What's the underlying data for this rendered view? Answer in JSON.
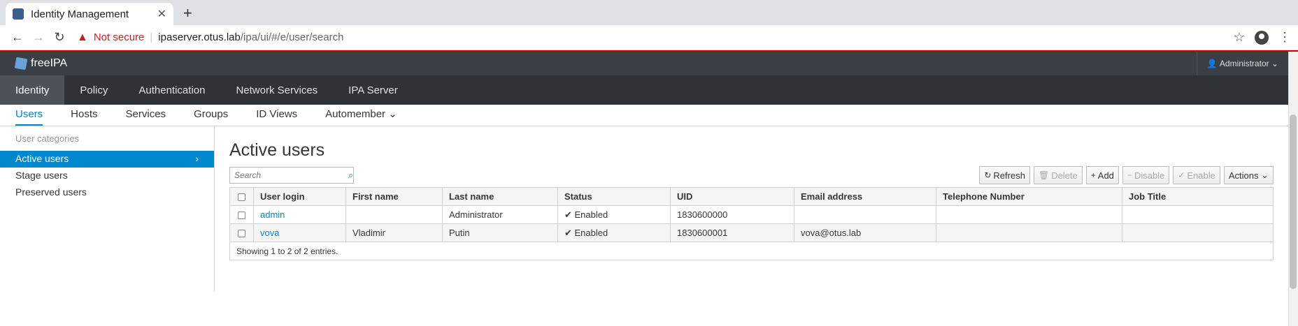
{
  "browser": {
    "tab_title": "Identity Management",
    "not_secure": "Not secure",
    "url_host": "ipaserver.otus.lab",
    "url_path": "/ipa/ui/#/e/user/search"
  },
  "masthead": {
    "brand": "freeIPA",
    "user": "Administrator"
  },
  "primary_nav": [
    "Identity",
    "Policy",
    "Authentication",
    "Network Services",
    "IPA Server"
  ],
  "secondary_nav": [
    "Users",
    "Hosts",
    "Services",
    "Groups",
    "ID Views",
    "Automember"
  ],
  "sidebar": {
    "category": "User categories",
    "items": [
      "Active users",
      "Stage users",
      "Preserved users"
    ]
  },
  "main": {
    "title": "Active users",
    "search_placeholder": "Search",
    "buttons": {
      "refresh": "Refresh",
      "delete": "Delete",
      "add": "Add",
      "disable": "Disable",
      "enable": "Enable",
      "actions": "Actions"
    },
    "columns": [
      "User login",
      "First name",
      "Last name",
      "Status",
      "UID",
      "Email address",
      "Telephone Number",
      "Job Title"
    ],
    "rows": [
      {
        "login": "admin",
        "first": "",
        "last": "Administrator",
        "status": "Enabled",
        "uid": "1830600000",
        "email": "",
        "phone": "",
        "job": ""
      },
      {
        "login": "vova",
        "first": "Vladimir",
        "last": "Putin",
        "status": "Enabled",
        "uid": "1830600001",
        "email": "vova@otus.lab",
        "phone": "",
        "job": ""
      }
    ],
    "footer": "Showing 1 to 2 of 2 entries."
  },
  "colors": {
    "accent": "#0088ce",
    "masthead": "#393f44",
    "nav": "#2f3337",
    "alert": "#cc0000"
  }
}
